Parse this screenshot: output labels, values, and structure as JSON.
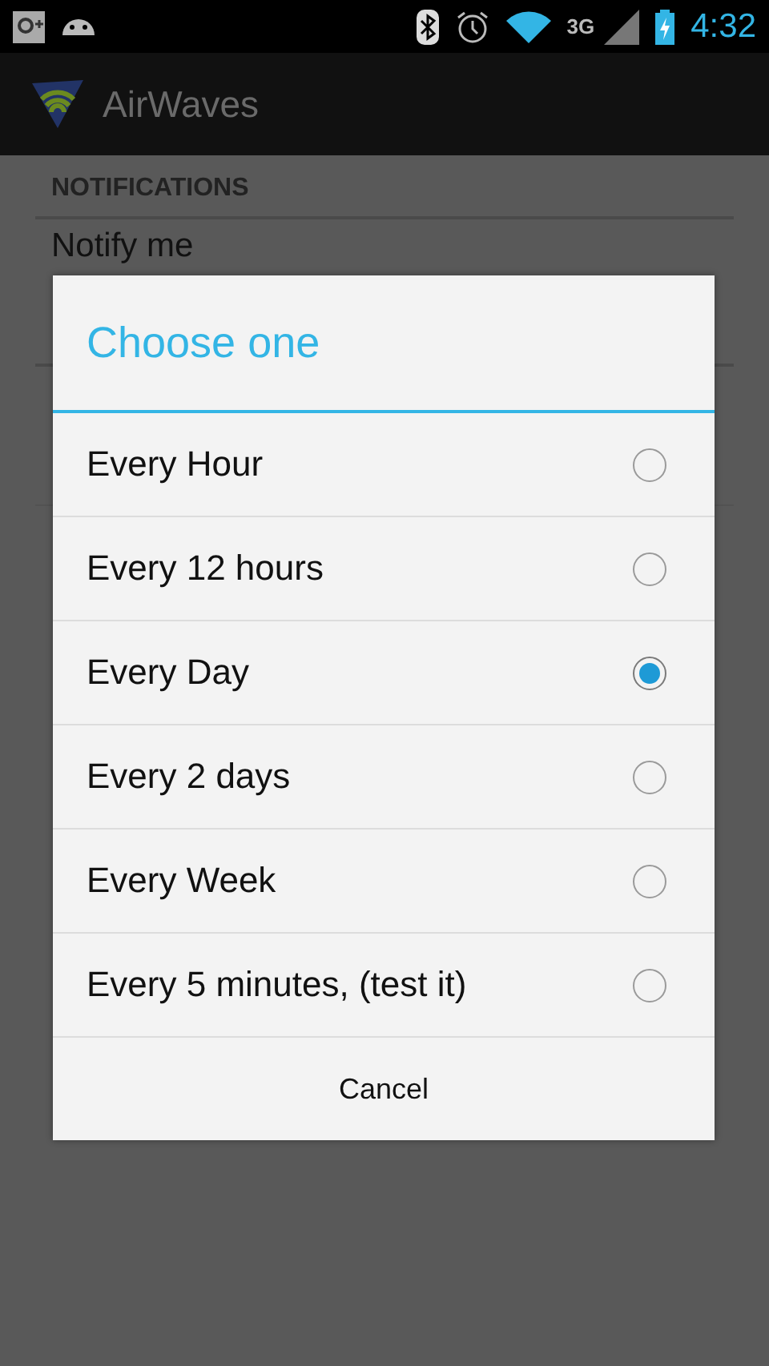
{
  "status_bar": {
    "network": "3G",
    "time": "4:32"
  },
  "app_bar": {
    "title": "AirWaves"
  },
  "settings": {
    "section": "NOTIFICATIONS",
    "items": [
      {
        "label": "Notify me"
      }
    ]
  },
  "dialog": {
    "title": "Choose one",
    "options": [
      {
        "label": "Every Hour",
        "selected": false
      },
      {
        "label": "Every 12 hours",
        "selected": false
      },
      {
        "label": "Every Day",
        "selected": true
      },
      {
        "label": "Every 2 days",
        "selected": false
      },
      {
        "label": "Every Week",
        "selected": false
      },
      {
        "label": "Every 5 minutes, (test it)",
        "selected": false
      }
    ],
    "button": "Cancel"
  }
}
